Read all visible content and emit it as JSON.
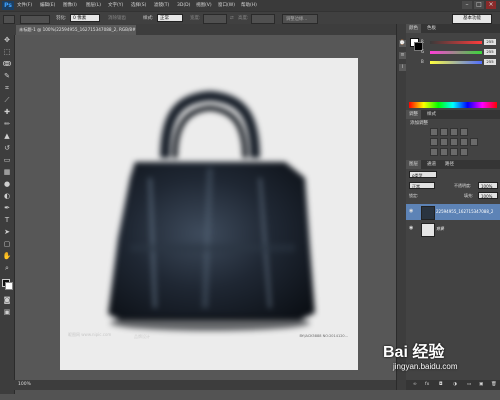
{
  "app": {
    "logo": "Ps",
    "menu": [
      "文件(F)",
      "编辑(E)",
      "图像(I)",
      "图层(L)",
      "文字(Y)",
      "选择(S)",
      "滤镜(T)",
      "3D(D)",
      "视图(V)",
      "窗口(W)",
      "帮助(H)"
    ],
    "window_controls": [
      "–",
      "□",
      "×"
    ]
  },
  "options_bar": {
    "feather_label": "羽化:",
    "feather_value": "0 像素",
    "antialias_label": "消除锯齿",
    "style_label": "样式:",
    "style_value": "正常",
    "width_label": "宽度:",
    "height_label": "高度:",
    "refine_edge": "调整边缘...",
    "workspace": "基本功能"
  },
  "document": {
    "tab_title": "未标题-1 @ 100%(22594955_162715347088_2, RGB/8#) ×",
    "zoom": "100%"
  },
  "canvas": {
    "watermark_left": "昵图网 www.nipic.com",
    "watermark_mid": "品牌设计",
    "watermark_right": "BY:JACK5888 NO:2014120..."
  },
  "panels": {
    "color_tabs": [
      "颜色",
      "色板"
    ],
    "sliders": [
      {
        "label": "R",
        "value": "255",
        "color": "#ff3c3c"
      },
      {
        "label": "G",
        "value": "255",
        "color": "#38d838"
      },
      {
        "label": "B",
        "value": "255",
        "color": "#4f6cff"
      }
    ],
    "adjust_tabs": [
      "调整",
      "样式"
    ],
    "adjust_title": "添加调整",
    "layers_tabs": [
      "图层",
      "通道",
      "路径"
    ],
    "kind_label": "ρ类型",
    "blend_mode": "正常",
    "opacity_label": "不透明度:",
    "opacity_value": "100%",
    "lock_label": "锁定:",
    "fill_label": "填充:",
    "fill_value": "100%",
    "layers": [
      {
        "name": "22594955_162715347088_2",
        "selected": true
      },
      {
        "name": "背景",
        "selected": false
      }
    ]
  },
  "watermark": {
    "main": "Bai 经验",
    "sub": "jingyan.baidu.com"
  }
}
